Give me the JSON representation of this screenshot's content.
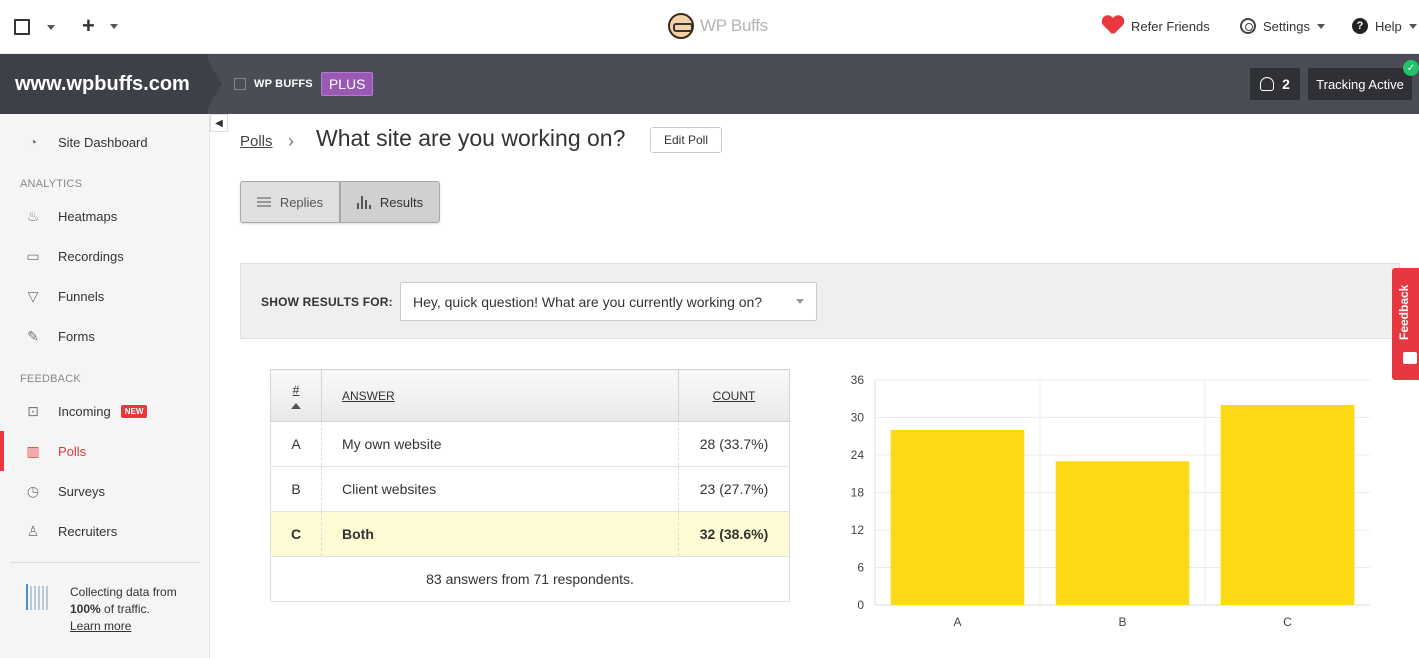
{
  "brand": {
    "name": "WP Buffs"
  },
  "topbar": {
    "refer_label": "Refer Friends",
    "settings_label": "Settings",
    "help_label": "Help"
  },
  "sitebar": {
    "site_name": "www.wpbuffs.com",
    "org_name": "WP BUFFS",
    "plan_badge": "PLUS",
    "users_count": "2",
    "tracking_label": "Tracking Active"
  },
  "sidebar": {
    "dashboard_label": "Site Dashboard",
    "analytics_heading": "ANALYTICS",
    "analytics_items": [
      "Heatmaps",
      "Recordings",
      "Funnels",
      "Forms"
    ],
    "feedback_heading": "FEEDBACK",
    "feedback_items": [
      "Incoming",
      "Polls",
      "Surveys",
      "Recruiters"
    ],
    "new_badge": "NEW",
    "collect_line1": "Collecting data from",
    "collect_percent": "100%",
    "collect_line2": " of traffic.",
    "learn_more": "Learn more"
  },
  "main": {
    "breadcrumb": "Polls",
    "title": "What site are you working on?",
    "edit_button": "Edit Poll",
    "tabs": [
      "Replies",
      "Results"
    ],
    "filter_label": "SHOW RESULTS FOR:",
    "filter_value": "Hey, quick question! What are you currently working on?"
  },
  "table": {
    "headers": [
      "#",
      "ANSWER",
      "COUNT"
    ],
    "rows": [
      {
        "id": "A",
        "answer": "My own website",
        "count": "28 (33.7%)"
      },
      {
        "id": "B",
        "answer": "Client websites",
        "count": "23 (27.7%)"
      },
      {
        "id": "C",
        "answer": "Both",
        "count": "32 (38.6%)"
      }
    ],
    "footer": "83 answers from 71 respondents."
  },
  "feedback_tab": "Feedback",
  "colors": {
    "accent": "#e8373f",
    "bar": "#fdd815",
    "plan": "#9b59b6",
    "highlight": "#fefcd4"
  },
  "chart_data": {
    "type": "bar",
    "categories": [
      "A",
      "B",
      "C"
    ],
    "values": [
      28,
      23,
      32
    ],
    "ylim": [
      0,
      36
    ],
    "yticks": [
      0,
      6,
      12,
      18,
      24,
      30,
      36
    ],
    "grid": true
  }
}
